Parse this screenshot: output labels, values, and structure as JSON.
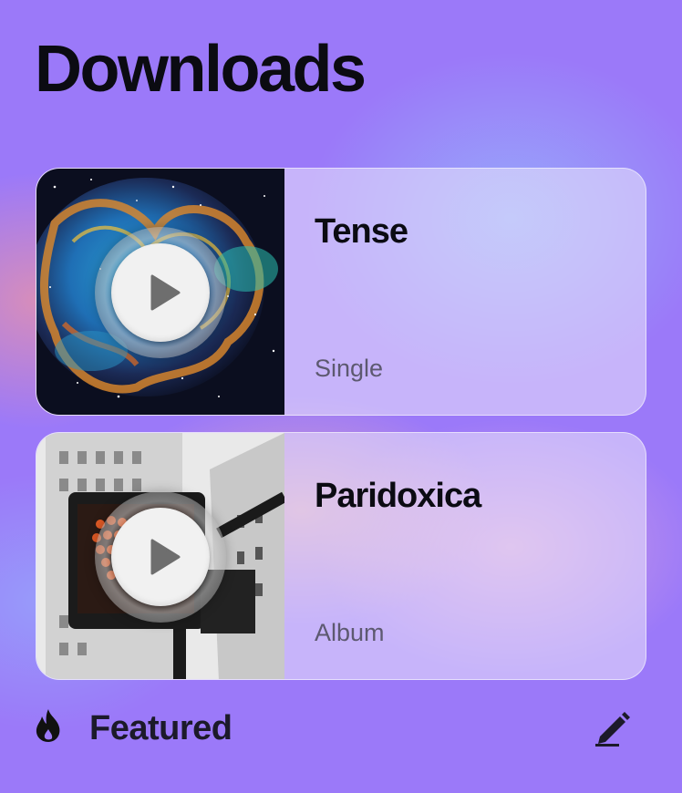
{
  "header": {
    "title": "Downloads"
  },
  "downloads": [
    {
      "title": "Tense",
      "type": "Single",
      "cover": "nebula-space-cover"
    },
    {
      "title": "Paridoxica",
      "type": "Album",
      "cover": "crosswalk-signal-cover"
    }
  ],
  "footer": {
    "featured_label": "Featured",
    "icon": "fire-icon",
    "action_icon": "edit-icon"
  },
  "colors": {
    "background": "#9b79f9",
    "text": "#0b0b12",
    "subtext": "#5d5970"
  }
}
